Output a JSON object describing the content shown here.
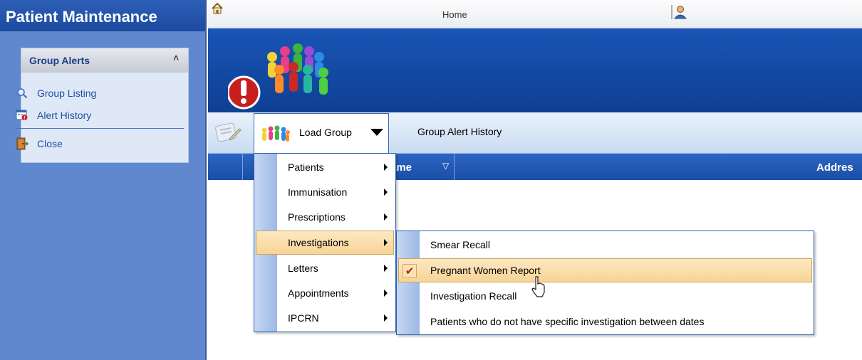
{
  "sidebar": {
    "title": "Patient Maintenance",
    "panel": {
      "header": "Group Alerts",
      "collapse_glyph": "˄",
      "items": [
        {
          "label": "Group Listing",
          "icon": "magnifier-icon"
        },
        {
          "label": "Alert History",
          "icon": "alert-history-icon"
        },
        {
          "label": "Close",
          "icon": "close-door-icon"
        }
      ]
    }
  },
  "topbar": {
    "home_label": "Home"
  },
  "toolbar": {
    "load_group_label": "Load Group",
    "group_alert_history_label": "Group Alert History"
  },
  "grid": {
    "col_name_partial": "ame",
    "filter_glyph": "▽",
    "col_address_partial": "Addres"
  },
  "load_menu": {
    "items": [
      {
        "label": "Patients"
      },
      {
        "label": "Immunisation"
      },
      {
        "label": "Prescriptions"
      },
      {
        "label": "Investigations"
      },
      {
        "label": "Letters"
      },
      {
        "label": "Appointments"
      },
      {
        "label": "IPCRN"
      }
    ],
    "highlighted": "Investigations"
  },
  "investigations_menu": {
    "items": [
      {
        "label": "Smear Recall"
      },
      {
        "label": "Pregnant Women Report"
      },
      {
        "label": "Investigation Recall"
      },
      {
        "label": "Patients who do not have specific investigation between dates"
      }
    ],
    "highlighted": "Pregnant Women Report",
    "check_glyph": "✔"
  },
  "colors": {
    "sidebar_bg": "#5f88cf",
    "banner_bg": "#1a55b5",
    "menu_highlight": "#f7d497",
    "link_blue": "#1d4fa3"
  }
}
